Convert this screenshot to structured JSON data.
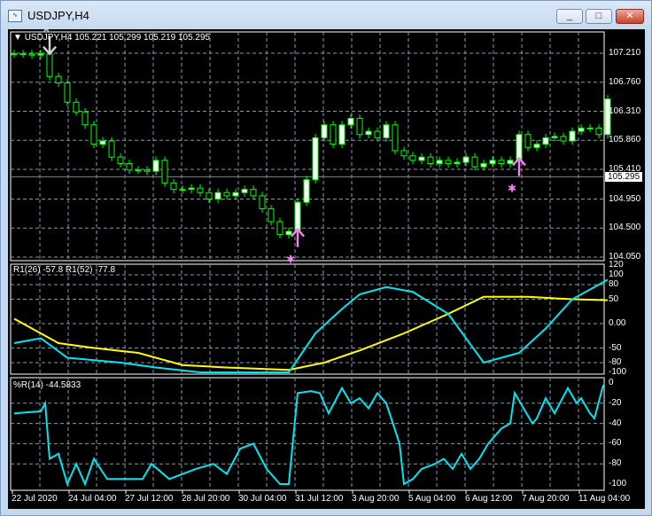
{
  "window": {
    "title": "USDJPY,H4",
    "min": "_",
    "max": "□",
    "close": "✕"
  },
  "main": {
    "legend": "USDJPY,H4  105.221 105.299 105.219 105.295",
    "current_price": "105.295",
    "price_axis": [
      "107.210",
      "106.760",
      "106.310",
      "105.860",
      "105.410",
      "104.950",
      "104.500",
      "104.050"
    ]
  },
  "ri": {
    "legend": "R1(26) -57.8  R1(52) -77.8",
    "axis": [
      "120",
      "100",
      "80",
      "50",
      "0.00",
      "-50",
      "-80",
      "-100"
    ]
  },
  "wpr": {
    "legend": "%R(14) -44.5833",
    "axis": [
      "0",
      "-20",
      "-40",
      "-60",
      "-80",
      "-100"
    ]
  },
  "time_labels": [
    "22 Jul 2020",
    "24 Jul 04:00",
    "27 Jul 12:00",
    "28 Jul 20:00",
    "30 Jul 04:00",
    "31 Jul 12:00",
    "3 Aug 20:00",
    "5 Aug 04:00",
    "6 Aug 12:00",
    "7 Aug 20:00",
    "11 Aug 04:00"
  ],
  "colors": {
    "bull": "#00ff00",
    "cyan": "#00e5ee",
    "yellow": "#ffff00",
    "arrow_down": "#d0d0d0",
    "arrow_up": "#ee82ee"
  },
  "chart_data": [
    {
      "type": "candlestick",
      "title": "USDJPY,H4",
      "ylim": [
        104.05,
        107.21
      ],
      "closes": [
        107.2,
        107.2,
        107.18,
        107.2,
        106.85,
        106.75,
        106.45,
        106.3,
        106.1,
        105.8,
        105.85,
        105.6,
        105.5,
        105.4,
        105.4,
        105.38,
        105.55,
        105.2,
        105.1,
        105.1,
        105.12,
        105.05,
        104.95,
        105.05,
        105.0,
        105.05,
        105.1,
        105.0,
        104.8,
        104.6,
        104.4,
        104.45,
        104.9,
        105.25,
        105.9,
        106.1,
        105.8,
        106.1,
        106.2,
        105.95,
        106.0,
        105.9,
        106.1,
        105.7,
        105.62,
        105.55,
        105.6,
        105.5,
        105.55,
        105.5,
        105.52,
        105.6,
        105.45,
        105.5,
        105.55,
        105.5,
        105.55,
        105.95,
        105.75,
        105.8,
        105.9,
        105.92,
        105.85,
        106.0,
        106.05,
        106.05,
        105.95,
        106.5
      ],
      "signals": [
        {
          "type": "sell",
          "index": 4
        },
        {
          "type": "buy",
          "index": 32
        },
        {
          "type": "buy",
          "index": 57
        }
      ]
    },
    {
      "type": "line",
      "title": "R1",
      "ylim": [
        -100,
        120
      ],
      "series": [
        {
          "name": "R1(26)",
          "points": [
            [
              0,
              -40
            ],
            [
              3,
              -30
            ],
            [
              6,
              -70
            ],
            [
              12,
              -80
            ],
            [
              16,
              -90
            ],
            [
              21,
              -100
            ],
            [
              31,
              -100
            ],
            [
              34,
              -20
            ],
            [
              37,
              30
            ],
            [
              39,
              60
            ],
            [
              42,
              75
            ],
            [
              45,
              65
            ],
            [
              49,
              20
            ],
            [
              53,
              -80
            ],
            [
              57,
              -60
            ],
            [
              60,
              -10
            ],
            [
              63,
              50
            ],
            [
              67,
              90
            ]
          ]
        },
        {
          "name": "R1(52)",
          "points": [
            [
              0,
              10
            ],
            [
              3,
              -20
            ],
            [
              5,
              -40
            ],
            [
              9,
              -50
            ],
            [
              14,
              -60
            ],
            [
              19,
              -85
            ],
            [
              24,
              -90
            ],
            [
              31,
              -95
            ],
            [
              35,
              -80
            ],
            [
              39,
              -55
            ],
            [
              44,
              -20
            ],
            [
              49,
              20
            ],
            [
              53,
              55
            ],
            [
              58,
              55
            ],
            [
              63,
              50
            ],
            [
              67,
              48
            ]
          ]
        }
      ]
    },
    {
      "type": "line",
      "title": "%R(14)",
      "ylim": [
        -100,
        0
      ],
      "series": [
        {
          "name": "%R(14)",
          "points": [
            [
              0,
              -30
            ],
            [
              3,
              -28
            ],
            [
              3.5,
              -20
            ],
            [
              4,
              -75
            ],
            [
              5,
              -70
            ],
            [
              6,
              -100
            ],
            [
              7,
              -80
            ],
            [
              8,
              -100
            ],
            [
              9,
              -75
            ],
            [
              10.5,
              -95
            ],
            [
              14.5,
              -95
            ],
            [
              15.5,
              -80
            ],
            [
              17.5,
              -95
            ],
            [
              20.5,
              -85
            ],
            [
              22.5,
              -80
            ],
            [
              24,
              -90
            ],
            [
              25.5,
              -65
            ],
            [
              27,
              -60
            ],
            [
              28.5,
              -85
            ],
            [
              30,
              -100
            ],
            [
              31,
              -100
            ],
            [
              32,
              -10
            ],
            [
              33.5,
              -8
            ],
            [
              34.5,
              -10
            ],
            [
              35.5,
              -30
            ],
            [
              37,
              -5
            ],
            [
              38,
              -20
            ],
            [
              39,
              -15
            ],
            [
              40,
              -25
            ],
            [
              41,
              -10
            ],
            [
              42,
              -20
            ],
            [
              43.5,
              -60
            ],
            [
              44,
              -100
            ],
            [
              45,
              -95
            ],
            [
              46,
              -85
            ],
            [
              47.5,
              -80
            ],
            [
              48.5,
              -75
            ],
            [
              49.5,
              -85
            ],
            [
              50.5,
              -70
            ],
            [
              51.5,
              -85
            ],
            [
              52.5,
              -75
            ],
            [
              53.5,
              -60
            ],
            [
              55,
              -45
            ],
            [
              56,
              -40
            ],
            [
              56.5,
              -10
            ],
            [
              57.5,
              -25
            ],
            [
              58.5,
              -40
            ],
            [
              59,
              -35
            ],
            [
              60,
              -15
            ],
            [
              61,
              -30
            ],
            [
              62.5,
              -5
            ],
            [
              63.5,
              -20
            ],
            [
              64,
              -15
            ],
            [
              65,
              -30
            ],
            [
              65.5,
              -35
            ],
            [
              66.5,
              -2
            ]
          ]
        }
      ]
    }
  ]
}
